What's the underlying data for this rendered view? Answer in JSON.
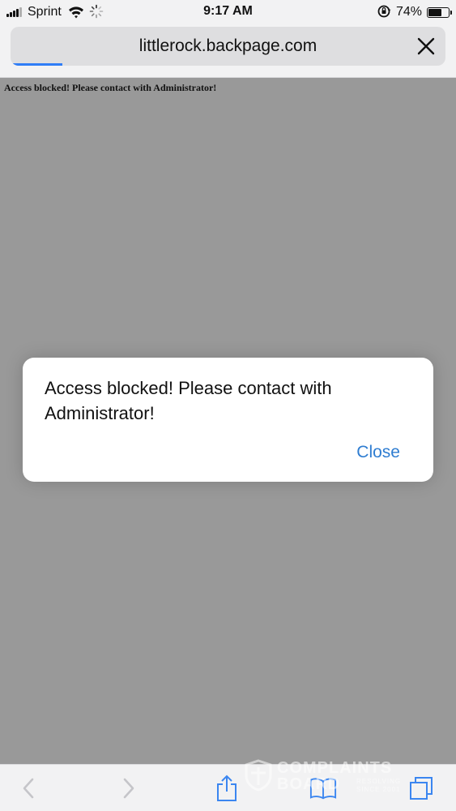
{
  "status_bar": {
    "carrier": "Sprint",
    "time": "9:17 AM",
    "battery_percent": "74%",
    "battery_level": 0.74
  },
  "url_bar": {
    "url": "littlerock.backpage.com",
    "load_progress": 0.12
  },
  "page": {
    "message": "Access blocked! Please contact with Administrator!"
  },
  "alert": {
    "message": "Access blocked! Please contact with Administrator!",
    "close_label": "Close"
  },
  "toolbar": {
    "items": [
      "back-icon",
      "forward-icon",
      "share-icon",
      "bookmarks-icon",
      "tabs-icon"
    ]
  },
  "watermark": {
    "line1": "COMPLAINTS",
    "line2": "BOARD",
    "tag1": "RESOLVING",
    "tag2": "SINCE 2001"
  },
  "colors": {
    "page_background": "#999999",
    "chrome": "#f2f2f3",
    "accent_blue": "#2f7dd1",
    "progress_blue": "#2f7df6",
    "toolbar_icon_blue": "#3b86f0",
    "disabled_icon": "#c5c5c9"
  }
}
